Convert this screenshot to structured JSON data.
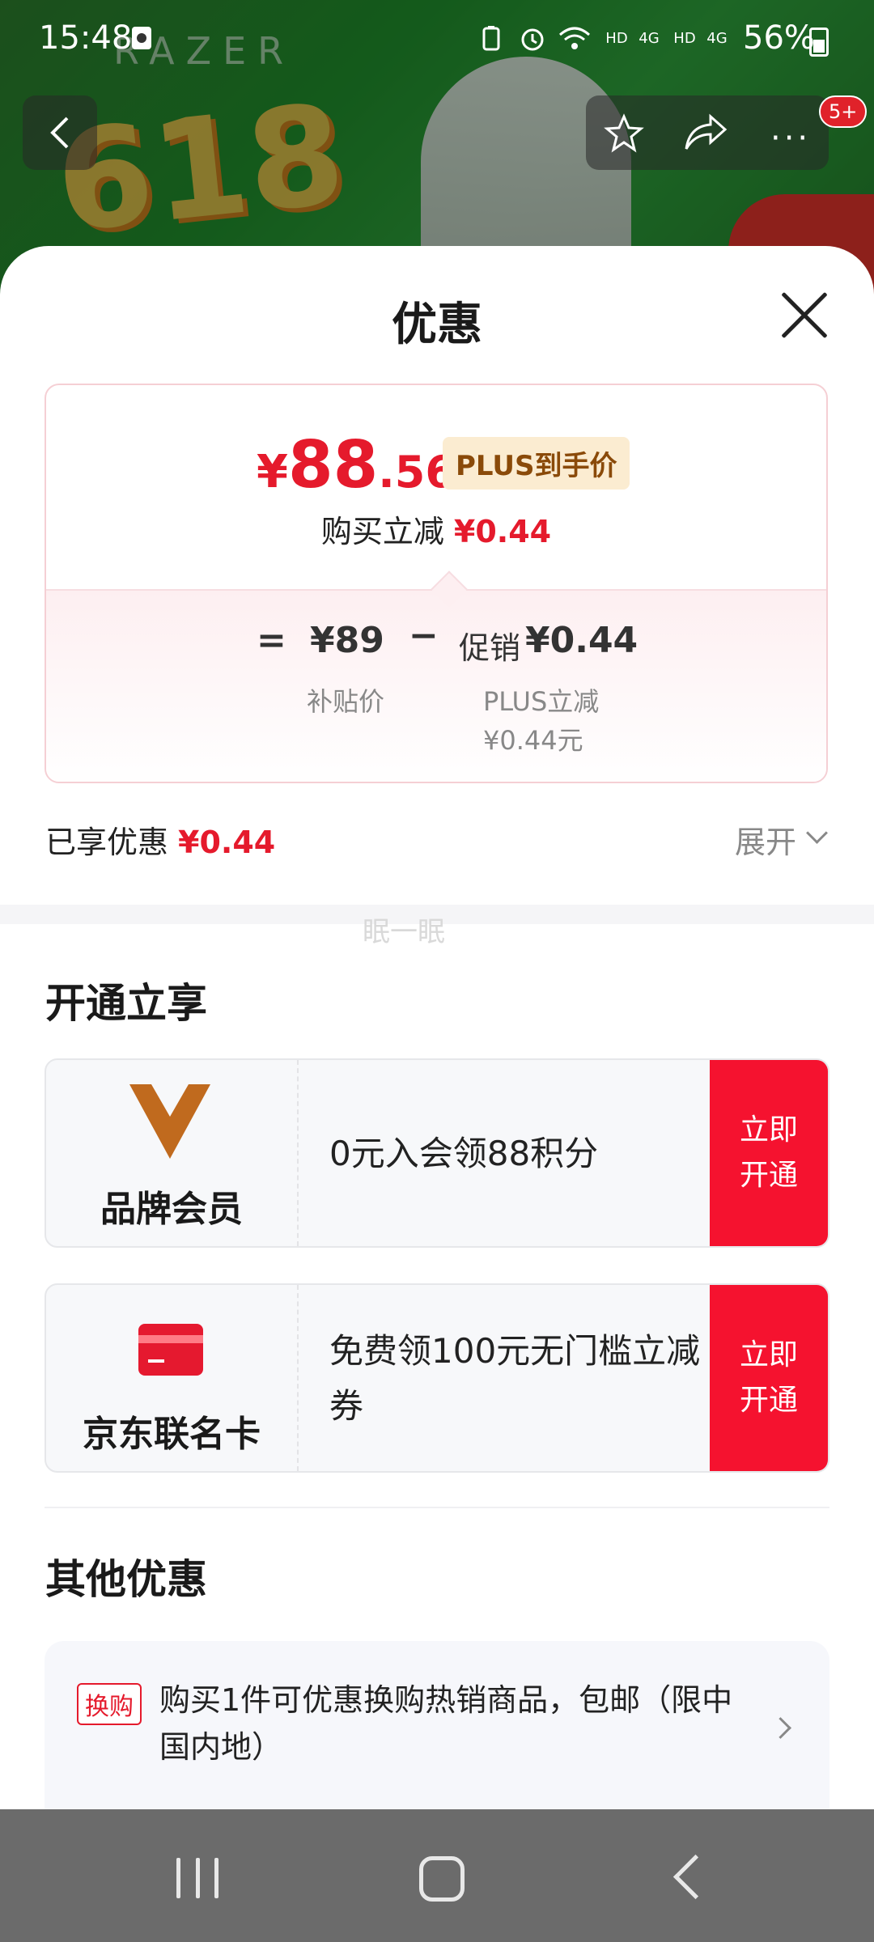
{
  "status_bar": {
    "time": "15:48",
    "battery": "56%",
    "network_label": "4G"
  },
  "background": {
    "brand": "RAZER",
    "promo": "618",
    "notification_badge": "5+"
  },
  "sheet": {
    "title": "优惠",
    "price_card": {
      "currency": "¥",
      "price_integer": "88",
      "price_decimal": ".56",
      "plus_tag": "PLUS到手价",
      "buy_reduce_label": "购买立减",
      "buy_reduce_value": "¥0.44",
      "formula": {
        "equals": "=",
        "base_price": "¥89",
        "minus": "−",
        "promo_label": "促销",
        "promo_value": "¥0.44",
        "base_caption": "补贴价",
        "promo_caption_line1": "PLUS立减",
        "promo_caption_line2": "¥0.44元"
      }
    },
    "enjoyed_label": "已享优惠",
    "enjoyed_value": "¥0.44",
    "expand_label": "展开",
    "watermark": "眠一眠",
    "open_section_title": "开通立享",
    "offers": [
      {
        "name": "品牌会员",
        "desc": "0元入会领88积分",
        "button": "立即开通",
        "icon": "brand-v-logo-icon"
      },
      {
        "name": "京东联名卡",
        "desc": "免费领100元无门槛立减券",
        "button": "立即开通",
        "icon": "credit-card-icon"
      }
    ],
    "other_section_title": "其他优惠",
    "other_offer": {
      "tag": "换购",
      "text": "购买1件可优惠换购热销商品，包邮（限中国内地）"
    }
  },
  "colors": {
    "accent_red": "#e51a2c",
    "button_red": "#f5122f",
    "plus_gold_bg": "#fbecd1",
    "plus_gold_text": "#8a4a09"
  }
}
